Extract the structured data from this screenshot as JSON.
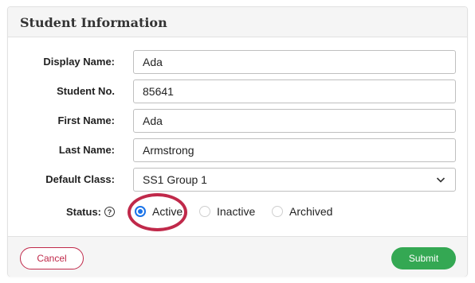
{
  "header": {
    "title": "Student Information"
  },
  "fields": [
    {
      "label": "Display Name:",
      "value": "Ada"
    },
    {
      "label": "Student No.",
      "value": "85641"
    },
    {
      "label": "First Name:",
      "value": "Ada"
    },
    {
      "label": "Last Name:",
      "value": "Armstrong"
    }
  ],
  "default_class": {
    "label": "Default Class:",
    "value": "SS1 Group 1"
  },
  "status": {
    "label": "Status:",
    "selected": "Active",
    "options": [
      {
        "label": "Active"
      },
      {
        "label": "Inactive"
      },
      {
        "label": "Archived"
      }
    ]
  },
  "footer": {
    "cancel_label": "Cancel",
    "submit_label": "Submit"
  },
  "colors": {
    "primary_radio": "#1a73e8",
    "highlight": "#c0294a",
    "cancel": "#c0294a",
    "submit": "#34a853"
  }
}
